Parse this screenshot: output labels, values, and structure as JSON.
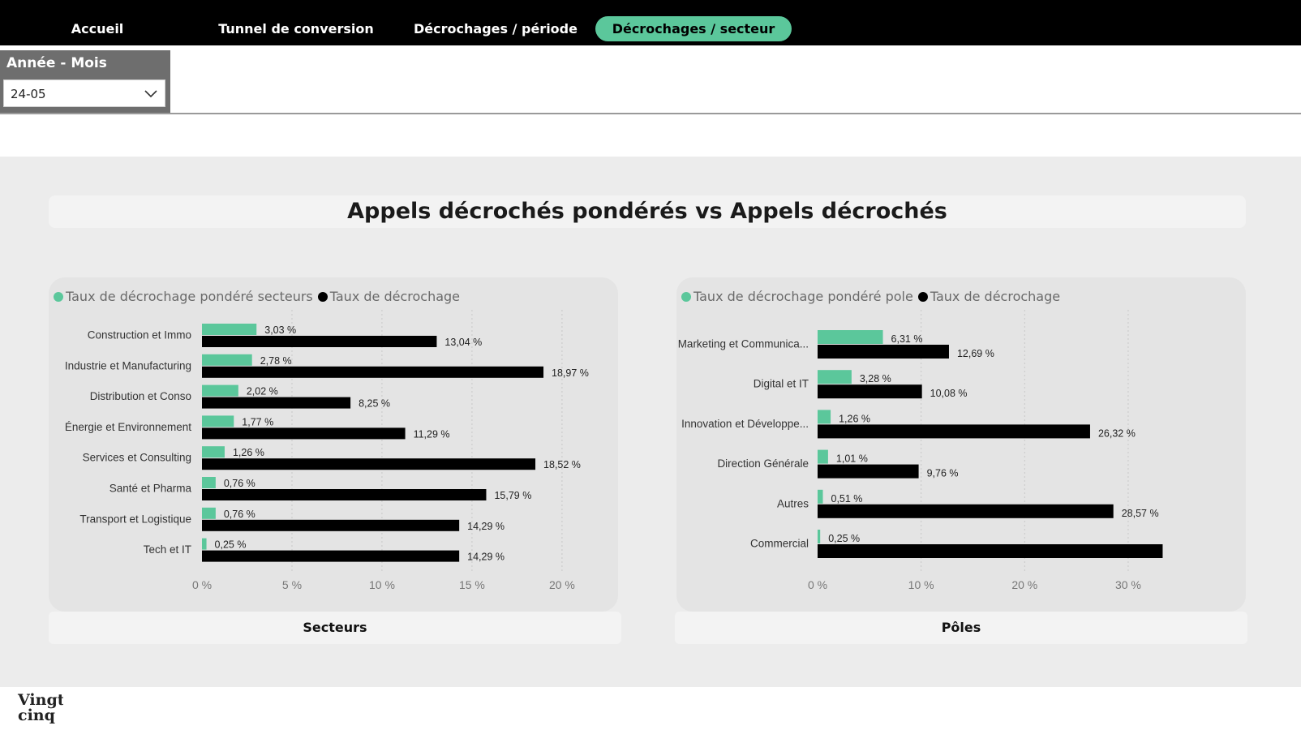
{
  "nav": {
    "tabs": [
      {
        "label": "Accueil",
        "active": false
      },
      {
        "label": "Tunnel de conversion",
        "active": false
      },
      {
        "label": "Décrochages / période",
        "active": false
      },
      {
        "label": "Décrochages / secteur",
        "active": true
      }
    ]
  },
  "filter": {
    "label": "Année - Mois",
    "value": "24-05"
  },
  "page_title": "Appels décrochés pondérés vs Appels décrochés",
  "colors": {
    "accent": "#5bc79b",
    "secondary": "#000000"
  },
  "logo": {
    "text": "Vingt cinq"
  },
  "chart_data": [
    {
      "type": "bar",
      "orientation": "horizontal",
      "title": "Secteurs",
      "legend": [
        "Taux de décrochage pondéré secteurs",
        "Taux de décrochage"
      ],
      "legend_placement": "top-left",
      "categories": [
        "Construction et Immo",
        "Industrie et Manufacturing",
        "Distribution et Conso",
        "Énergie et Environnement",
        "Services et Consulting",
        "Santé et Pharma",
        "Transport et Logistique",
        "Tech et IT"
      ],
      "series": [
        {
          "name": "Taux de décrochage pondéré secteurs",
          "color": "#5bc79b",
          "values": [
            3.03,
            2.78,
            2.02,
            1.77,
            1.26,
            0.76,
            0.76,
            0.25
          ],
          "labels": [
            "3,03 %",
            "2,78 %",
            "2,02 %",
            "1,77 %",
            "1,26 %",
            "0,76 %",
            "0,76 %",
            "0,25 %"
          ]
        },
        {
          "name": "Taux de décrochage",
          "color": "#000000",
          "values": [
            13.04,
            18.97,
            8.25,
            11.29,
            18.52,
            15.79,
            14.29,
            14.29
          ],
          "labels": [
            "13,04 %",
            "18,97 %",
            "8,25 %",
            "11,29 %",
            "18,52 %",
            "15,79 %",
            "14,29 %",
            "14,29 %"
          ]
        }
      ],
      "xlim": [
        0,
        20.5
      ],
      "ticks": [
        0,
        5,
        10,
        15,
        20
      ],
      "tick_labels": [
        "0 %",
        "5 %",
        "10 %",
        "15 %",
        "20 %"
      ],
      "grid": true
    },
    {
      "type": "bar",
      "orientation": "horizontal",
      "title": "Pôles",
      "legend": [
        "Taux de décrochage pondéré pole",
        "Taux de décrochage"
      ],
      "legend_placement": "top-left",
      "categories": [
        "Marketing et Communica...",
        "Digital et IT",
        "Innovation et Développe...",
        "Direction Générale",
        "Autres",
        "Commercial"
      ],
      "series": [
        {
          "name": "Taux de décrochage pondéré pole",
          "color": "#5bc79b",
          "values": [
            6.31,
            3.28,
            1.26,
            1.01,
            0.51,
            0.25
          ],
          "labels": [
            "6,31 %",
            "3,28 %",
            "1,26 %",
            "1,01 %",
            "0,51 %",
            "0,25 %"
          ]
        },
        {
          "name": "Taux de décrochage",
          "color": "#000000",
          "values": [
            12.69,
            10.08,
            26.32,
            9.76,
            28.57,
            33.33
          ],
          "labels": [
            "12,69 %",
            "10,08 %",
            "26,32 %",
            "9,76 %",
            "28,57 %",
            ""
          ]
        }
      ],
      "xlim": [
        0,
        34
      ],
      "ticks": [
        0,
        10,
        20,
        30
      ],
      "tick_labels": [
        "0 %",
        "10 %",
        "20 %",
        "30 %"
      ],
      "grid": true
    }
  ]
}
